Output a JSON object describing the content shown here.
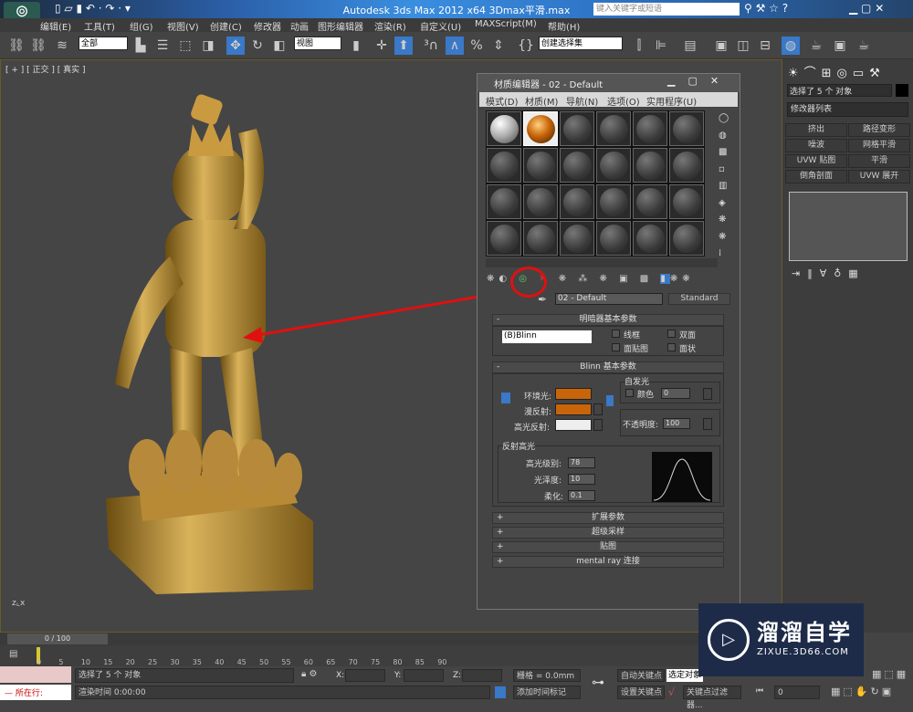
{
  "title_bar": {
    "title": "Autodesk 3ds Max  2012 x64      3Dmax平滑.max",
    "search_placeholder": "键入关键字或短语"
  },
  "menu": [
    "编辑(E)",
    "工具(T)",
    "组(G)",
    "视图(V)",
    "创建(C)",
    "修改器",
    "动画",
    "图形编辑器",
    "渲染(R)",
    "自定义(U)",
    "MAXScript(M)",
    "帮助(H)"
  ],
  "toolbar": {
    "selection_filter": "全部",
    "reference_coord": "视图",
    "named_selection": "创建选择集"
  },
  "viewport": {
    "label": "[ + ] [ 正交 ] [ 真实 ]"
  },
  "command_panel": {
    "object_name": "选择了 5 个 对象",
    "modifier_list": "修改器列表",
    "modifier_buttons": [
      "挤出",
      "路径变形",
      "噪波",
      "网格平滑",
      "UVW 贴图",
      "平滑",
      "倒角剖面",
      "UVW 展开"
    ]
  },
  "material_editor": {
    "title": "材质编辑器 - 02 - Default",
    "menu": [
      "模式(D)",
      "材质(M)",
      "导航(N)",
      "选项(O)",
      "实用程序(U)"
    ],
    "material_name": "02 - Default",
    "material_type": "Standard",
    "shader_rollout": {
      "title": "明暗器基本参数",
      "shader": "(B)Blinn",
      "checks": [
        "线框",
        "双面",
        "面贴图",
        "面状"
      ]
    },
    "blinn_rollout": {
      "title": "Blinn 基本参数",
      "ambient_label": "环境光:",
      "diffuse_label": "漫反射:",
      "specular_label": "高光反射:",
      "ambient_color": "#c8650a",
      "diffuse_color": "#c8650a",
      "specular_color": "#eeeeee",
      "self_illum_title": "自发光",
      "self_illum_color_label": "颜色",
      "self_illum_value": "0",
      "opacity_label": "不透明度:",
      "opacity_value": "100",
      "spec_title": "反射高光",
      "spec_level_label": "高光级别:",
      "spec_level": "78",
      "gloss_label": "光泽度:",
      "gloss": "10",
      "soften_label": "柔化:",
      "soften": "0.1"
    },
    "collapsed_rollouts": [
      "扩展参数",
      "超级采样",
      "贴图",
      "mental ray 连接"
    ]
  },
  "timeline": {
    "frame": "0 / 100",
    "ticks": [
      "0",
      "5",
      "10",
      "15",
      "20",
      "25",
      "30",
      "35",
      "40",
      "45",
      "50",
      "55",
      "60",
      "65",
      "70",
      "75",
      "80",
      "85",
      "90"
    ]
  },
  "status": {
    "selection": "选择了 5 个 对象",
    "render_time": "渲染时间 0:00:00",
    "x_label": "X:",
    "y_label": "Y:",
    "z_label": "Z:",
    "grid": "栅格 = 0.0mm",
    "add_time_tag": "添加时间标记",
    "auto_key": "自动关键点",
    "set_key": "设置关键点",
    "selected": "选定对象",
    "key_filters": "关键点过滤器...",
    "frame_value": "0",
    "script_label": "所在行:"
  },
  "watermark": {
    "name": "溜溜自学",
    "url": "ZIXUE.3D66.COM"
  },
  "accent_color": "#e01010"
}
